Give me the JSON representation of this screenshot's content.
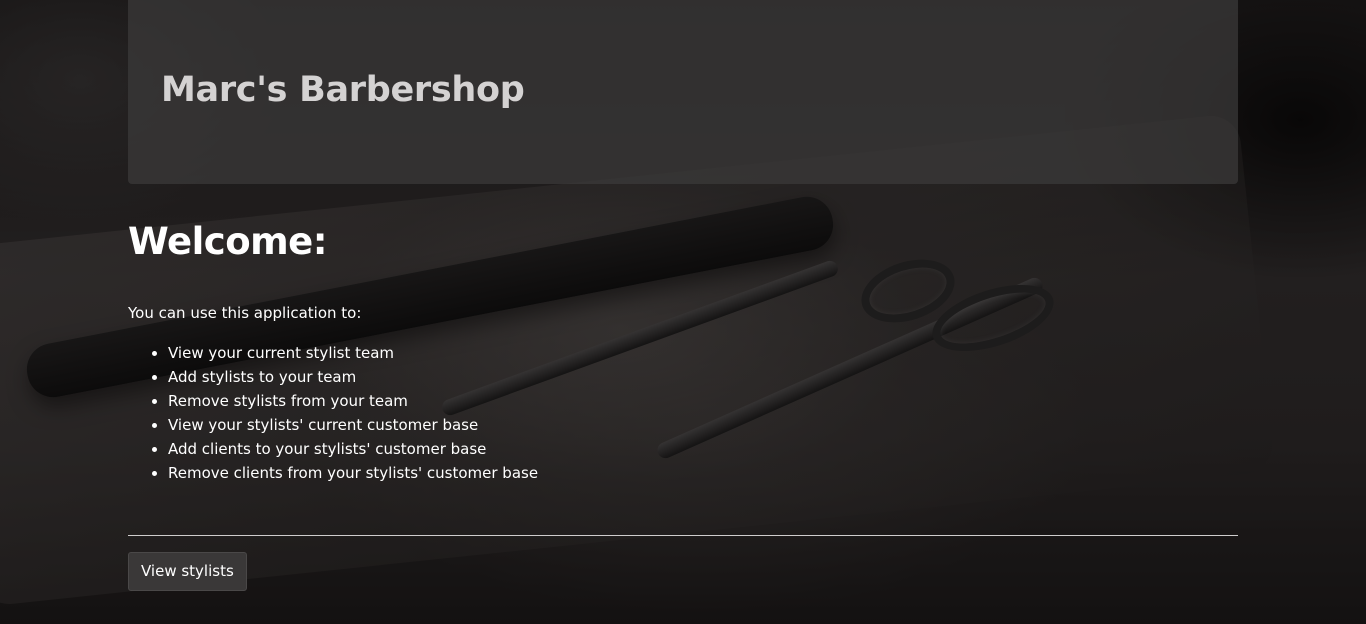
{
  "header": {
    "title": "Marc's Barbershop"
  },
  "main": {
    "heading": "Welcome:",
    "intro": "You can use this application to:",
    "features": [
      "View your current stylist team",
      "Add stylists to your team",
      "Remove stylists from your team",
      "View your stylists' current customer base",
      "Add clients to your stylists' customer base",
      "Remove clients from your stylists' customer base"
    ],
    "view_button_label": "View stylists"
  },
  "background": {
    "description_icon": "barber-tools-photo"
  }
}
